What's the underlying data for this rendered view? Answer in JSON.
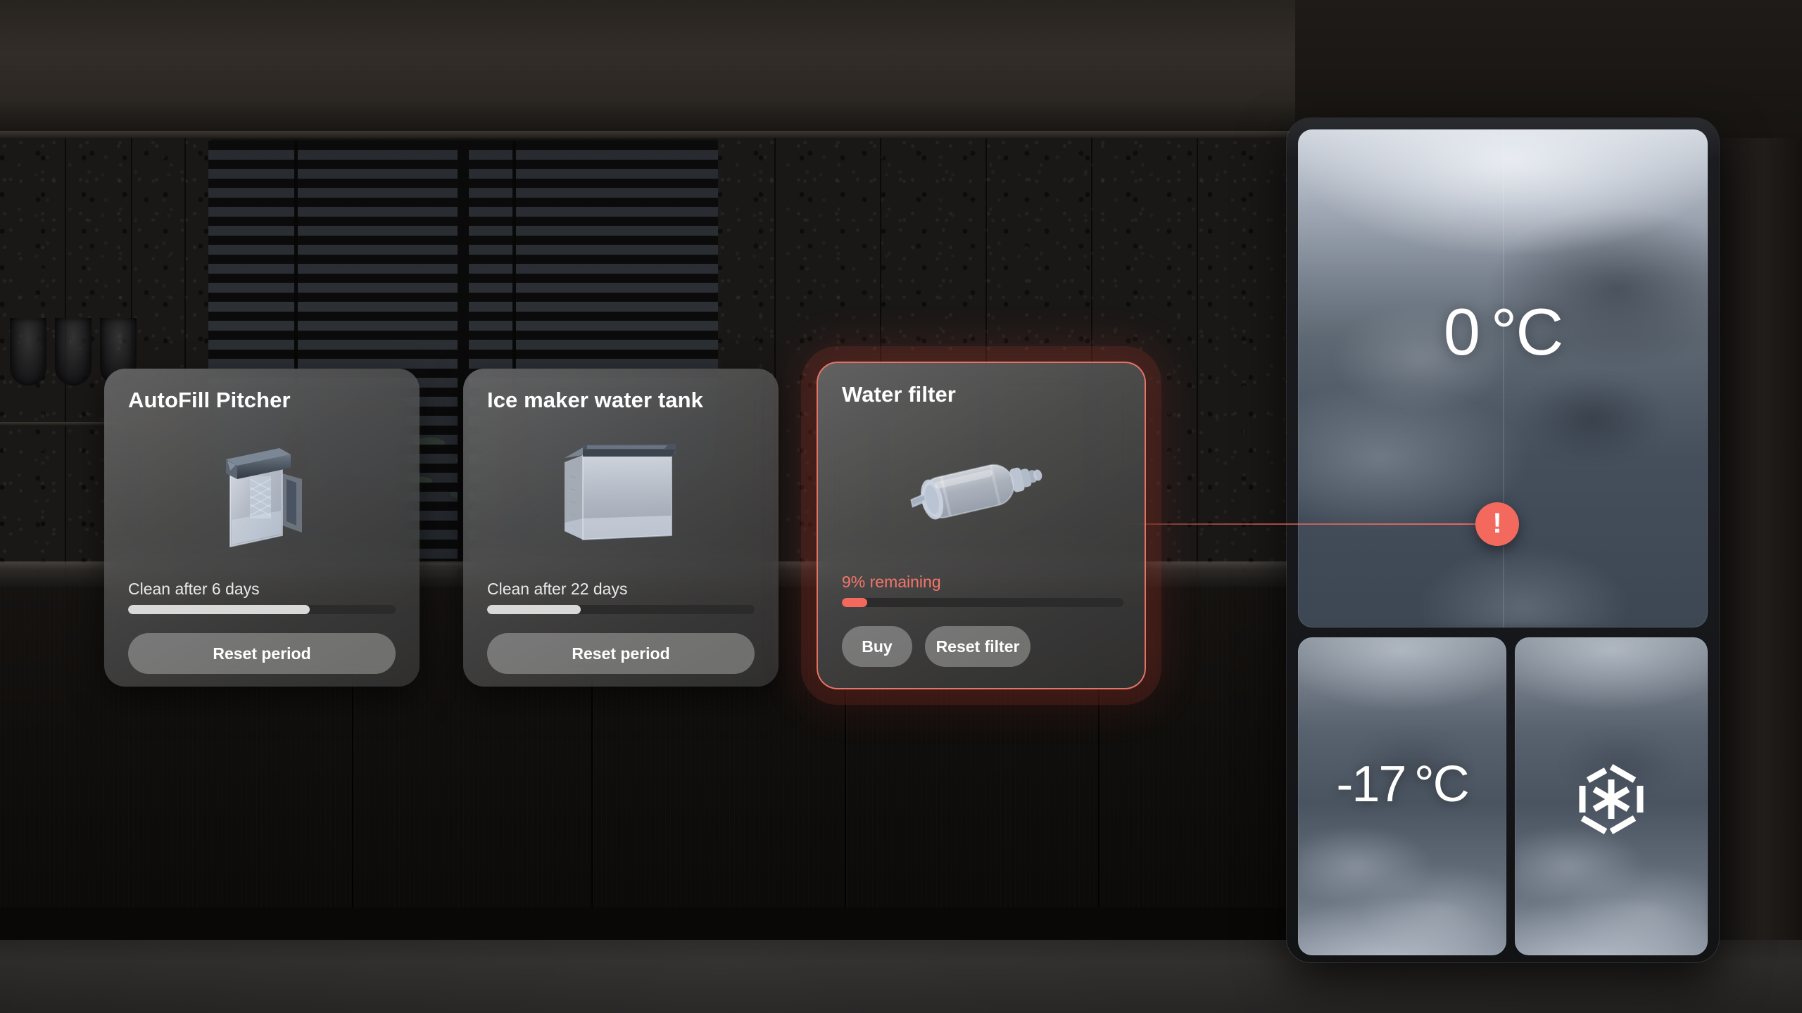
{
  "scene": {
    "name": "Smart refrigerator water management screen",
    "accent_alert_color": "#f3695d",
    "card_surface_color": "#6b6b6b"
  },
  "cards": [
    {
      "id": "autofill-pitcher",
      "title": "AutoFill Pitcher",
      "art_icon": "water-pitcher-icon",
      "status_text": "Clean after 6 days",
      "status_alert": false,
      "progress_percent": 68,
      "progress_fill_color": "#d9d9d9",
      "buttons": [
        {
          "id": "reset-period",
          "label": "Reset period"
        }
      ]
    },
    {
      "id": "ice-maker-water-tank",
      "title": "Ice maker water tank",
      "art_icon": "water-tank-icon",
      "status_text": "Clean after 22 days",
      "status_alert": false,
      "progress_percent": 35,
      "progress_fill_color": "#d9d9d9",
      "buttons": [
        {
          "id": "reset-period",
          "label": "Reset period"
        }
      ]
    },
    {
      "id": "water-filter",
      "title": "Water filter",
      "art_icon": "water-filter-cartridge-icon",
      "status_text": "9% remaining",
      "status_alert": true,
      "progress_percent": 9,
      "progress_fill_color": "#f3695d",
      "buttons": [
        {
          "id": "buy",
          "label": "Buy"
        },
        {
          "id": "reset-filter",
          "label": "Reset filter"
        }
      ]
    }
  ],
  "appliance": {
    "name": "refrigerator",
    "compartments": [
      {
        "id": "fridge",
        "display": "0 °C",
        "icon": null
      },
      {
        "id": "freezer-left",
        "display": "-17 °C",
        "icon": null
      },
      {
        "id": "freezer-right",
        "display": "",
        "icon": "snowflake-icon"
      }
    ],
    "alert": {
      "badge_glyph": "!",
      "badge_color": "#f3695d",
      "linked_card": "water-filter"
    }
  }
}
